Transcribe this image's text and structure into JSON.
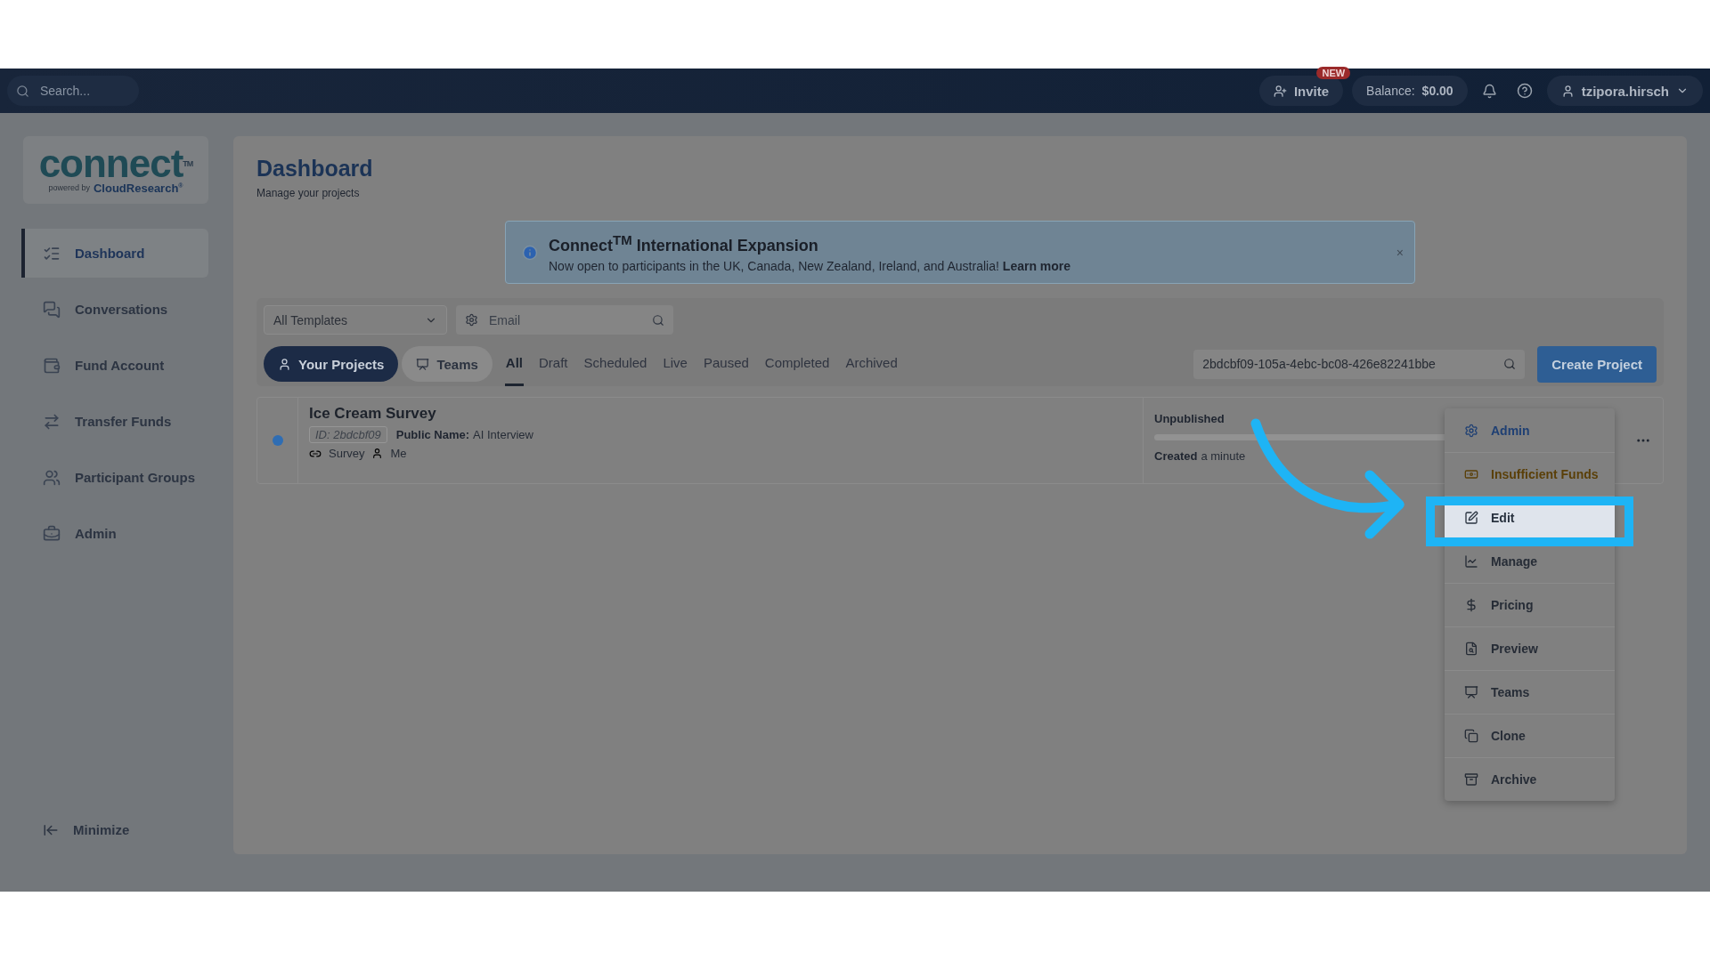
{
  "top_bar": {
    "search": {
      "placeholder": "Search..."
    },
    "invite": {
      "label": "Invite",
      "badge": "NEW"
    },
    "balance": {
      "label": "Balance:",
      "value": "$0.00"
    },
    "user": "tzipora.hirsch"
  },
  "logo": {
    "word": "connect",
    "tm": "TM",
    "powered_by": "powered by",
    "brand": "CloudResearch",
    "reg": "®"
  },
  "sidebar": {
    "items": [
      {
        "label": "Dashboard",
        "selected": true
      },
      {
        "label": "Conversations",
        "selected": false
      },
      {
        "label": "Fund Account",
        "selected": false
      },
      {
        "label": "Transfer Funds",
        "selected": false
      },
      {
        "label": "Participant Groups",
        "selected": false
      },
      {
        "label": "Admin",
        "selected": false
      }
    ],
    "minimize": "Minimize"
  },
  "header": {
    "title": "Dashboard",
    "subtitle": "Manage your projects"
  },
  "banner": {
    "title": "Connect$^{TM}$ International Expansion",
    "text": "Now open to participants in the UK, Canada, New Zealand, Ireland, and Australia!",
    "link": "Learn more",
    "close": "×"
  },
  "filters": {
    "template": "All Templates",
    "email": {
      "placeholder": "Email"
    },
    "project_search": "2bdcbf09-105a-4ebc-bc08-426e82241bbe",
    "create": "Create Project"
  },
  "scope_tabs": [
    {
      "label": "Your Projects",
      "selected": true
    },
    {
      "label": "Teams",
      "selected": false
    }
  ],
  "status_tabs": [
    {
      "label": "All",
      "selected": true
    },
    {
      "label": "Draft",
      "selected": false
    },
    {
      "label": "Scheduled",
      "selected": false
    },
    {
      "label": "Live",
      "selected": false
    },
    {
      "label": "Paused",
      "selected": false
    },
    {
      "label": "Completed",
      "selected": false
    },
    {
      "label": "Archived",
      "selected": false
    }
  ],
  "project": {
    "title": "Ice Cream Survey",
    "color": "#2f6db3",
    "id": "ID: 2bdcbf09",
    "public_label": "Public Name:",
    "public_name": "AI Interview",
    "type": "Survey",
    "owner": "Me",
    "status": "Unpublished",
    "level": 0,
    "created_label": "Created",
    "created": "a minute"
  },
  "menu": [
    {
      "label": "Admin",
      "kind": "admin",
      "selected": false
    },
    {
      "label": "Insufficient Funds",
      "kind": "warning",
      "selected": false
    },
    {
      "label": "Edit",
      "kind": "normal",
      "selected": true
    },
    {
      "label": "Manage",
      "kind": "normal",
      "selected": false
    },
    {
      "label": "Pricing",
      "kind": "normal",
      "selected": false
    },
    {
      "label": "Preview",
      "kind": "normal",
      "selected": false
    },
    {
      "label": "Teams",
      "kind": "normal",
      "selected": false
    },
    {
      "label": "Clone",
      "kind": "normal",
      "selected": false
    },
    {
      "label": "Archive",
      "kind": "normal",
      "selected": false
    }
  ]
}
